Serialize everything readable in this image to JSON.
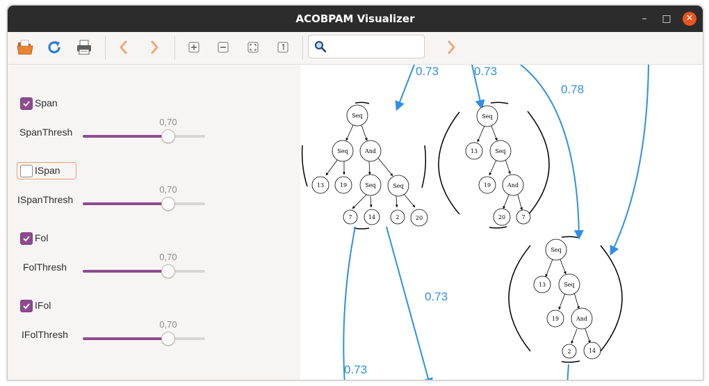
{
  "window": {
    "title": "ACOBPAM Visualizer"
  },
  "toolbar": {
    "buttons": [
      "open",
      "reload",
      "print",
      "back",
      "forward",
      "zoom-in",
      "zoom-out",
      "zoom-fit",
      "zoom-original"
    ],
    "search": {
      "value": "",
      "placeholder": ""
    },
    "find_next": "forward"
  },
  "controls": [
    {
      "label": "Span",
      "checked": true,
      "threshold_label": "SpanThresh",
      "value_text": "0,70",
      "value": 0.7
    },
    {
      "label": "ISpan",
      "checked": false,
      "threshold_label": "ISpanThresh",
      "value_text": "0,70",
      "value": 0.7
    },
    {
      "label": "Fol",
      "checked": true,
      "threshold_label": "FolThresh",
      "value_text": "0,70",
      "value": 0.7
    },
    {
      "label": "IFol",
      "checked": true,
      "threshold_label": "IFolThresh",
      "value_text": "0,70",
      "value": 0.7
    }
  ],
  "graph": {
    "edge_labels": [
      "0.73",
      "0.73",
      "0.78",
      "0.73",
      "0.73"
    ],
    "tree1": {
      "root": "Seq",
      "a": "Seq",
      "b": "And",
      "c": "Seq",
      "d": "Seq",
      "leaves": [
        "13",
        "19",
        "7",
        "14",
        "2",
        "20"
      ]
    },
    "tree2": {
      "root": "Seq",
      "a": "Seq",
      "b": "And",
      "leaves": [
        "13",
        "19",
        "20",
        "7"
      ]
    },
    "tree3": {
      "root": "Seq",
      "a": "Seq",
      "b": "And",
      "leaves": [
        "13",
        "19",
        "2",
        "14"
      ]
    }
  },
  "colors": {
    "accent": "#8e4b8f",
    "edge": "#2f8ee6",
    "titlebar": "#2c2c2c",
    "close": "#e9541f"
  }
}
